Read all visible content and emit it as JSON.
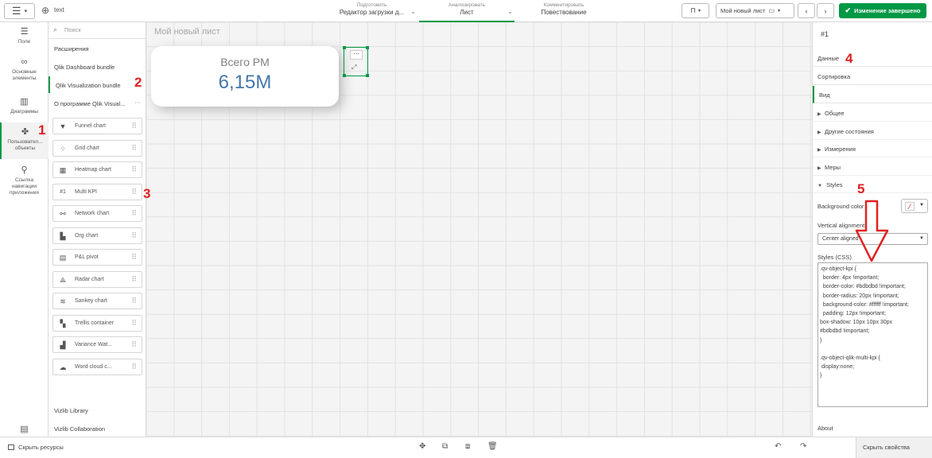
{
  "topbar": {
    "app_name": "text",
    "tabs": [
      {
        "small": "Подготовить",
        "big": "Редактор загрузки д..."
      },
      {
        "small": "Анализировать",
        "big": "Лист"
      },
      {
        "small": "Комментировать",
        "big": "Повествование"
      }
    ],
    "sheet_selector": "Мой новый лист",
    "done_button": "Изменение завершено"
  },
  "rail": {
    "items": [
      {
        "icon": "database-icon",
        "label": "Поле"
      },
      {
        "icon": "link-icon",
        "label": "Основные элементы"
      },
      {
        "icon": "chart-icon",
        "label": "Диаграммы"
      },
      {
        "icon": "puzzle-icon",
        "label": "Пользовател... объекты"
      },
      {
        "icon": "signpost-icon",
        "label": "Ссылка навигации приложения"
      }
    ]
  },
  "assets": {
    "search_placeholder": "Поиск",
    "extensions": "Расширения",
    "dashboard_bundle": "Qlik Dashboard bundle",
    "visualization_bundle": "Qlik Visualization bundle",
    "about_bundle": "О программе Qlik Visual...",
    "objects": [
      {
        "icon": "funnel-icon",
        "label": "Funnel chart"
      },
      {
        "icon": "grid-chart-icon",
        "label": "Grid chart"
      },
      {
        "icon": "heatmap-icon",
        "label": "Heatmap chart"
      },
      {
        "icon": "multi-kpi-icon",
        "label": "Multi KPI"
      },
      {
        "icon": "network-icon",
        "label": "Network chart"
      },
      {
        "icon": "org-chart-icon",
        "label": "Org chart"
      },
      {
        "icon": "pivot-icon",
        "label": "P&L pivot"
      },
      {
        "icon": "radar-icon",
        "label": "Radar chart"
      },
      {
        "icon": "sankey-icon",
        "label": "Sankey chart"
      },
      {
        "icon": "trellis-icon",
        "label": "Trellis container"
      },
      {
        "icon": "variance-icon",
        "label": "Variance Wat..."
      },
      {
        "icon": "word-cloud-icon",
        "label": "Word cloud c..."
      }
    ],
    "vizlib_library": "Vizlib Library",
    "vizlib_collaboration": "Vizlib Collaboration"
  },
  "canvas": {
    "sheet_title": "Мой новый лист",
    "kpi_title": "Всего PM",
    "kpi_value": "6,15M",
    "more_glyph": "⋯",
    "expand_glyph": "⤢"
  },
  "props": {
    "title": "#1",
    "data": "Данные",
    "sorting": "Сортировка",
    "view": "Вид",
    "sections": [
      "Общее",
      "Другие состояния",
      "Измерения",
      "Меры"
    ],
    "styles": "Styles",
    "background_color_label": "Background color",
    "vertical_alignment_label": "Vertical alignment",
    "vertical_alignment_value": "Center aligned",
    "styles_css_label": "Styles (CSS)",
    "styles_css_value": ".qv-object-kpi {\n  border: 4px !important;\n  border-color: #bdbdbd !important;\n  border-radius: 20px !important;\n  background-color: #ffffff !important;\n  padding: 12px !important;\nbox-shadow: 10px 10px 30px\n#bdbdbd !important;\n}\n\n.qv-object-qlik-multi-kpi {\n display:none;\n}",
    "about": "About"
  },
  "bottombar": {
    "hide_assets": "Скрыть ресурсы",
    "hide_properties": "Скрыть свойства"
  },
  "annotations": [
    "1",
    "2",
    "3",
    "4",
    "5"
  ],
  "colors": {
    "accent": "#009845",
    "kpi_value": "#4477aa",
    "annotation": "#e02020"
  }
}
